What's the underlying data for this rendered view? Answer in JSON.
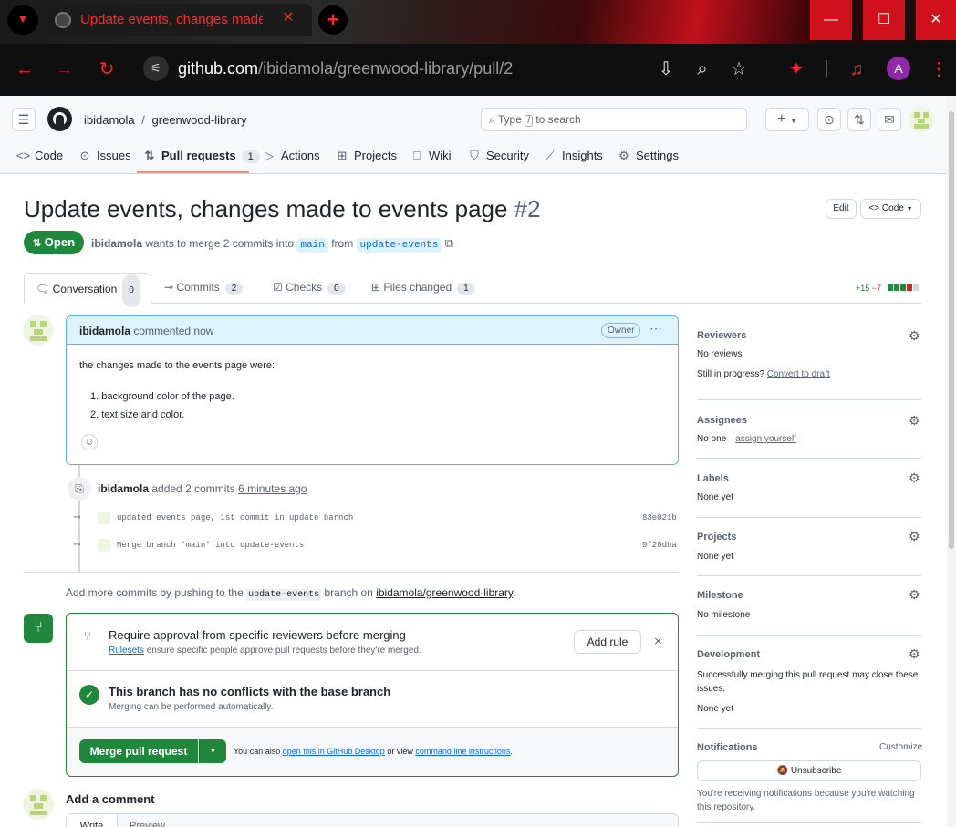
{
  "browser": {
    "tab_title": "Update events, changes made t",
    "tab_close": "×",
    "new_tab": "+",
    "url_host": "github.com",
    "url_path": "/ibidamola/greenwood-library/pull/2",
    "profile_initial": "A",
    "win_minimize": "—",
    "win_maximize": "☐",
    "win_close": "✕"
  },
  "header": {
    "owner": "ibidamola",
    "separator": "/",
    "repo": "greenwood-library",
    "search_prefix": "Type",
    "search_key": "/",
    "search_suffix": "to search",
    "plus": "+"
  },
  "nav": {
    "items": [
      {
        "label": "Code",
        "icon": "code-icon",
        "glyph": "<>"
      },
      {
        "label": "Issues",
        "icon": "issue-icon",
        "glyph": "⊙"
      },
      {
        "label": "Pull requests",
        "icon": "pull-request-icon",
        "glyph": "⇅",
        "count": "1"
      },
      {
        "label": "Actions",
        "icon": "play-icon",
        "glyph": "▷"
      },
      {
        "label": "Projects",
        "icon": "table-icon",
        "glyph": "⊞"
      },
      {
        "label": "Wiki",
        "icon": "book-icon",
        "glyph": "⎕"
      },
      {
        "label": "Security",
        "icon": "shield-icon",
        "glyph": "⛉"
      },
      {
        "label": "Insights",
        "icon": "graph-icon",
        "glyph": "⟋"
      },
      {
        "label": "Settings",
        "icon": "gear-icon",
        "glyph": "⚙"
      }
    ]
  },
  "pr": {
    "title": "Update events, changes made to events page",
    "number": "#2",
    "edit": "Edit",
    "code": "Code",
    "state": "Open",
    "author": "ibidamola",
    "meta_text": "wants to merge 2 commits into",
    "base": "main",
    "from": "from",
    "head": "update-events",
    "tabs": [
      {
        "label": "Conversation",
        "count": "0"
      },
      {
        "label": "Commits",
        "count": "2"
      },
      {
        "label": "Checks",
        "count": "0"
      },
      {
        "label": "Files changed",
        "count": "1"
      }
    ],
    "additions": "+15",
    "deletions": "−7"
  },
  "comment": {
    "author": "ibidamola",
    "action": "commented now",
    "badge": "Owner",
    "intro": "the changes made to the events page were:",
    "list": [
      "background color of the page.",
      "text size and color."
    ]
  },
  "commits_event": {
    "author": "ibidamola",
    "text": "added 2 commits",
    "time": "6 minutes ago",
    "commits": [
      {
        "message": "updated events page, 1st commit in update barnch",
        "sha": "83e021b"
      },
      {
        "message": "Merge branch 'main' into update-events",
        "sha": "9f28dba"
      }
    ]
  },
  "push_hint": {
    "prefix": "Add more commits by pushing to the",
    "branch": "update-events",
    "middle": "branch on",
    "repo": "ibidamola/greenwood-library",
    "suffix": "."
  },
  "merge_box": {
    "rule_title": "Require approval from specific reviewers before merging",
    "rule_link": "Rulesets",
    "rule_desc": "ensure specific people approve pull requests before they're merged.",
    "add_rule": "Add rule",
    "dismiss": "×",
    "conflict_title": "This branch has no conflicts with the base branch",
    "conflict_desc": "Merging can be performed automatically.",
    "merge_button": "Merge pull request",
    "also_prefix": "You can also",
    "desktop_link": "open this in GitHub Desktop",
    "or_view": "or view",
    "cli_link": "command line instructions",
    "period": "."
  },
  "add_comment": {
    "title": "Add a comment",
    "write": "Write",
    "preview": "Preview"
  },
  "sidebar": {
    "reviewers": {
      "label": "Reviewers",
      "value": "No reviews",
      "progress": "Still in progress?",
      "draft": "Convert to draft"
    },
    "assignees": {
      "label": "Assignees",
      "value": "No one—",
      "assign": "assign yourself"
    },
    "labels": {
      "label": "Labels",
      "value": "None yet"
    },
    "projects": {
      "label": "Projects",
      "value": "None yet"
    },
    "milestone": {
      "label": "Milestone",
      "value": "No milestone"
    },
    "development": {
      "label": "Development",
      "desc": "Successfully merging this pull request may close these issues.",
      "value": "None yet"
    },
    "notifications": {
      "label": "Notifications",
      "customize": "Customize",
      "unsubscribe": "Unsubscribe",
      "desc": "You're receiving notifications because you're watching this repository."
    }
  },
  "colors": {
    "accent": "#1f883d",
    "link": "#0969da",
    "chrome_red": "#d0111b"
  }
}
